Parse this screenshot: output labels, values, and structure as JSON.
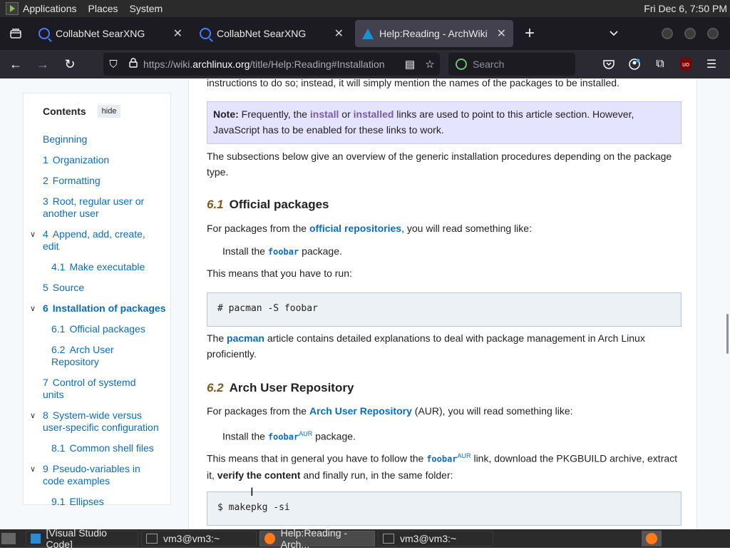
{
  "panel": {
    "menus": [
      "Applications",
      "Places",
      "System"
    ],
    "clock": "Fri Dec 6, 7:50 PM"
  },
  "tabs": [
    {
      "label": "CollabNet SearXNG",
      "icon": "searxng-icon",
      "active": false
    },
    {
      "label": "CollabNet SearXNG",
      "icon": "searxng-icon",
      "active": false
    },
    {
      "label": "Help:Reading - ArchWiki",
      "icon": "arch-icon",
      "active": true
    }
  ],
  "urlbar": {
    "url_prefix": "https://wiki.",
    "url_domain": "archlinux.org",
    "url_rest": "/title/Help:Reading#Installation"
  },
  "search": {
    "placeholder": "Search"
  },
  "toc": {
    "title": "Contents",
    "hide": "hide",
    "items": [
      {
        "num": "",
        "label": "Beginning"
      },
      {
        "num": "1",
        "label": "Organization"
      },
      {
        "num": "2",
        "label": "Formatting"
      },
      {
        "num": "3",
        "label": "Root, regular user or another user"
      },
      {
        "num": "4",
        "label": "Append, add, create, edit"
      },
      {
        "num": "4.1",
        "label": "Make executable"
      },
      {
        "num": "5",
        "label": "Source"
      },
      {
        "num": "6",
        "label": "Installation of packages"
      },
      {
        "num": "6.1",
        "label": "Official packages"
      },
      {
        "num": "6.2",
        "label": "Arch User Repository"
      },
      {
        "num": "7",
        "label": "Control of systemd units"
      },
      {
        "num": "8",
        "label": "System-wide versus user-specific configuration"
      },
      {
        "num": "8.1",
        "label": "Common shell files"
      },
      {
        "num": "9",
        "label": "Pseudo-variables in code examples"
      },
      {
        "num": "9.1",
        "label": "Ellipses"
      }
    ]
  },
  "article": {
    "intro_tail": "instructions to do so; instead, it will simply mention the names of the packages to be installed.",
    "note_label": "Note:",
    "note_a": " Frequently, the ",
    "note_link1": "install",
    "note_or": " or ",
    "note_link2": "installed",
    "note_b": " links are used to point to this article section. However, JavaScript has to be enabled for these links to work.",
    "subsections": "The subsections below give an overview of the generic installation procedures depending on the package type.",
    "h61_num": "6.1",
    "h61_title": "Official packages",
    "p61_a": "For packages from the ",
    "p61_link": "official repositories",
    "p61_b": ", you will read something like:",
    "install1_a": "Install the ",
    "install1_pkg": "foobar",
    "install1_b": " package.",
    "means_run": "This means that you have to run:",
    "code1": "# pacman -S foobar",
    "pacman_a": "The ",
    "pacman_link": "pacman",
    "pacman_b": " article contains detailed explanations to deal with package management in Arch Linux proficiently.",
    "h62_num": "6.2",
    "h62_title": "Arch User Repository",
    "p62_a": "For packages from the ",
    "p62_link": "Arch User Repository",
    "p62_b": " (AUR), you will read something like:",
    "install2_a": "Install the ",
    "install2_pkg": "foobar",
    "aur_sup": "AUR",
    "install2_b": " package.",
    "follow_a": "This means that in general you have to follow the ",
    "follow_pkg": "foobar",
    "follow_b": " link, download the PKGBUILD archive, extract it, ",
    "follow_bold": "verify the content",
    "follow_c": " and finally run, in the same folder:",
    "code2": "$ makepkg -si"
  },
  "taskbar": {
    "tasks": [
      {
        "label": "[Visual Studio Code]",
        "icon": "vscode-icon"
      },
      {
        "label": "vm3@vm3:~",
        "icon": "terminal-icon"
      },
      {
        "label": "Help:Reading - Arch...",
        "icon": "firefox-icon"
      },
      {
        "label": "vm3@vm3:~",
        "icon": "terminal-icon"
      }
    ]
  },
  "colors": {
    "link": "#0b6cbf",
    "note_bg": "#e4e4ff",
    "code_bg": "#ebf1f5"
  }
}
